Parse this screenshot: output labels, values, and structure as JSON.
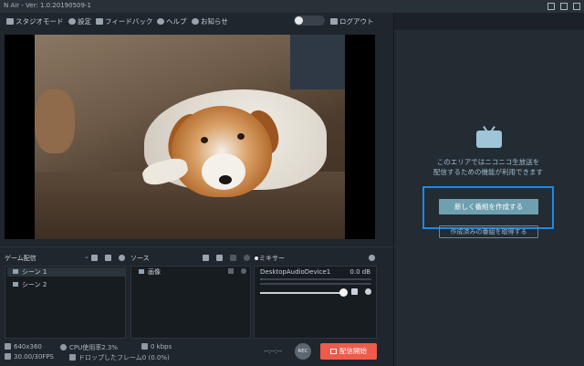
{
  "window": {
    "title": "N Air - Ver: 1.0.20190509-1"
  },
  "toolbar": {
    "studio_mode": "スタジオモード",
    "settings": "設定",
    "feedback": "フィードバック",
    "help": "ヘルプ",
    "news": "お知らせ",
    "logout": "ログアウト"
  },
  "right_panel": {
    "info_line1": "このエリアではニコニコ生放送を",
    "info_line2": "配信するための機能が利用できます",
    "create_button": "新しく番組を作成する",
    "fetch_button": "作成済みの番組を取得する"
  },
  "scenes": {
    "header": "ゲーム配信",
    "items": [
      {
        "label": "シーン 1",
        "selected": true
      },
      {
        "label": "シーン 2",
        "selected": false
      }
    ]
  },
  "sources": {
    "header": "ソース",
    "items": [
      {
        "label": "画像"
      }
    ]
  },
  "mixer": {
    "header": "ミキサー",
    "device": "DesktopAudioDevice1",
    "level": "0.0 dB"
  },
  "footer": {
    "resolution": "640x360",
    "cpu": "CPU使用率2.3%",
    "bitrate": "0 kbps",
    "fps": "30.00/30FPS",
    "dropped": "ドロップしたフレーム0 (0.0%)",
    "timer": "--:--:--",
    "rec": "REC",
    "start": "配信開始"
  },
  "colors": {
    "accent_blue": "#1e88e5",
    "start_red": "#ef5a4a",
    "create_btn": "#6fa0b0"
  }
}
